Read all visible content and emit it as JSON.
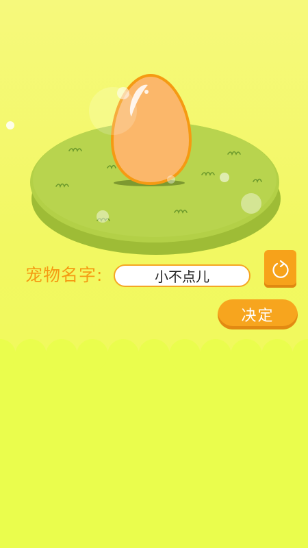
{
  "pet_name_form": {
    "label": "宠物名字:",
    "name_value": "小不点儿",
    "refresh_icon": "refresh-icon",
    "confirm_label": "决定"
  },
  "colors": {
    "accent": "#f7a21a",
    "label": "#f59a12",
    "grass": "#aecb3e",
    "egg": "#fbb76a",
    "background": "#f2f862"
  }
}
